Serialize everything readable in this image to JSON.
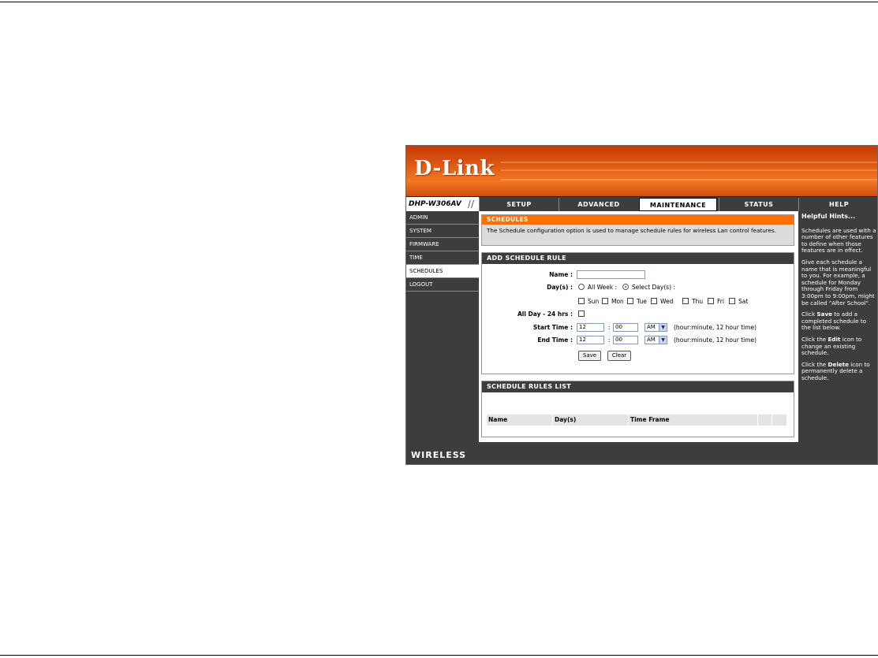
{
  "brand": {
    "logo": "D-Link",
    "model": "DHP-W306AV"
  },
  "nav": {
    "tabs": [
      "SETUP",
      "ADVANCED",
      "MAINTENANCE",
      "STATUS",
      "HELP"
    ],
    "active": "MAINTENANCE"
  },
  "sidebar": {
    "items": [
      "ADMIN",
      "SYSTEM",
      "FIRMWARE",
      "TIME",
      "SCHEDULES",
      "LOGOUT"
    ],
    "active": "SCHEDULES"
  },
  "schedules": {
    "title": "SCHEDULES",
    "description": "The Schedule configuration option is used to manage schedule rules for wireless Lan control features."
  },
  "add_rule": {
    "title": "ADD SCHEDULE RULE",
    "name_label": "Name :",
    "name_value": "",
    "days_label": "Day(s) :",
    "all_week": "All Week :",
    "select_days": "Select Day(s) :",
    "days_selected_mode": "Select Day(s)",
    "days": [
      "Sun",
      "Mon",
      "Tue",
      "Wed",
      "Thu",
      "Fri",
      "Sat"
    ],
    "all_day_label": "All Day - 24 hrs :",
    "start_label": "Start Time :",
    "start_hour": "12",
    "start_min": "00",
    "start_ampm": "AM",
    "end_label": "End Time :",
    "end_hour": "12",
    "end_min": "00",
    "end_ampm": "AM",
    "colon": ":",
    "time_hint": "(hour:minute, 12 hour time)",
    "save": "Save",
    "clear": "Clear"
  },
  "rules_list": {
    "title": "SCHEDULE RULES LIST",
    "columns": [
      "Name",
      "Day(s)",
      "Time Frame",
      "",
      ""
    ]
  },
  "hints": {
    "title": "Helpful Hints...",
    "p1": "Schedules are used with a number of other features to define when those features are in effect.",
    "p2": "Give each schedule a name that is meaningful to you. For example, a schedule for Monday through Friday from 3:00pm to 9:00pm, might be called \"After School\".",
    "p3_pre": "Click ",
    "p3_bold": "Save",
    "p3_post": " to add a completed schedule to the list below.",
    "p4_pre": "Click the ",
    "p4_bold": "Edit",
    "p4_post": " icon to change an existing schedule.",
    "p5_pre": "Click the ",
    "p5_bold": "Delete",
    "p5_post": " icon to permanently delete a schedule."
  },
  "footer": {
    "label": "WIRELESS"
  }
}
